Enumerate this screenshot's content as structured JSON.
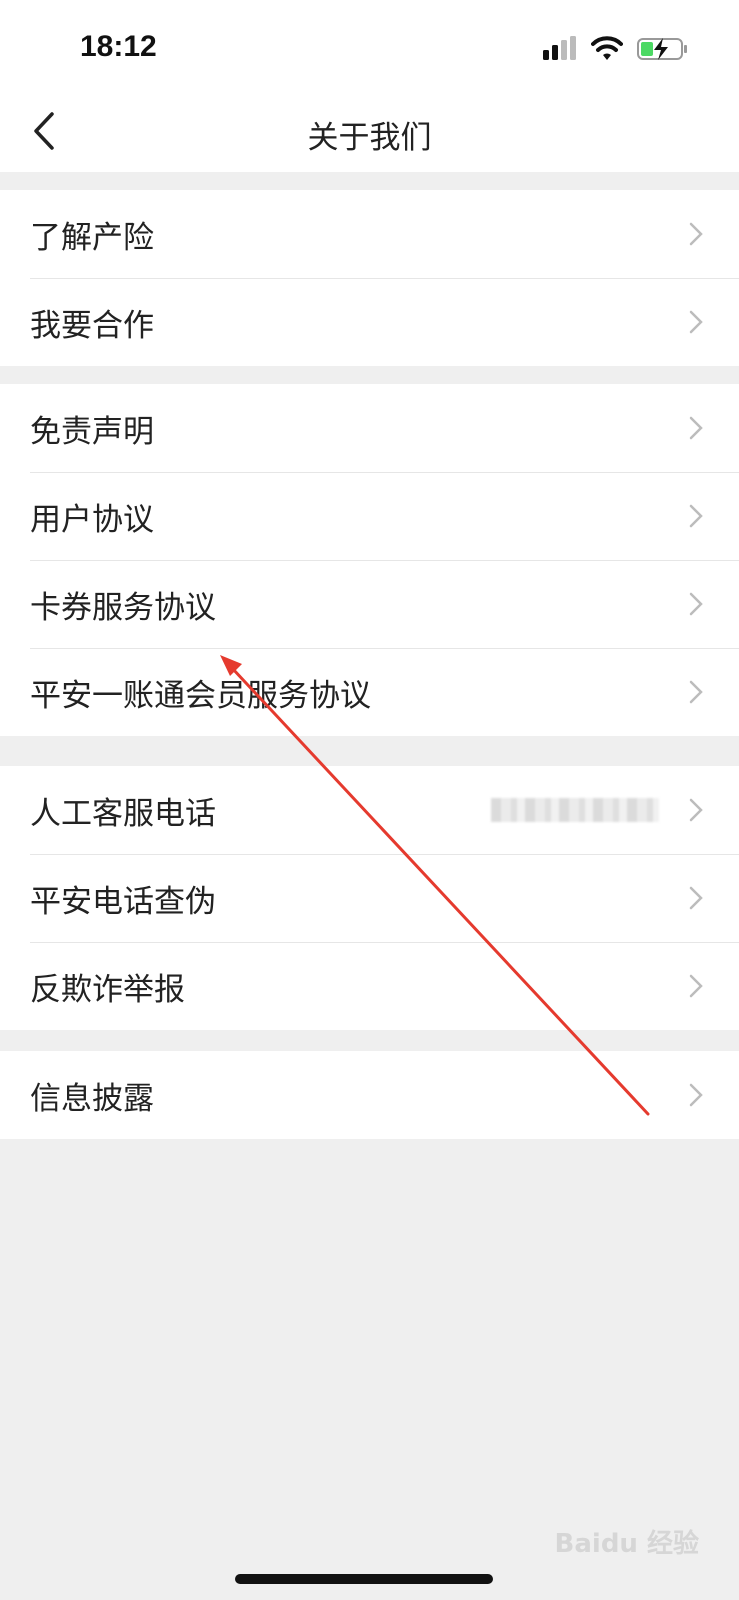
{
  "status_bar": {
    "time": "18:12",
    "icons": [
      "signal-icon",
      "wifi-icon",
      "battery-charging-icon"
    ]
  },
  "nav": {
    "title": "关于我们",
    "back_icon": "back-chevron-icon"
  },
  "groups": [
    {
      "items": [
        {
          "label": "了解产险"
        },
        {
          "label": "我要合作"
        }
      ]
    },
    {
      "items": [
        {
          "label": "免责声明"
        },
        {
          "label": "用户协议"
        },
        {
          "label": "卡券服务协议"
        },
        {
          "label": "平安一账通会员服务协议"
        }
      ]
    },
    {
      "items": [
        {
          "label": "人工客服电话"
        },
        {
          "label": "平安电话查伪"
        },
        {
          "label": "反欺诈举报"
        }
      ]
    },
    {
      "items": [
        {
          "label": "信息披露"
        }
      ]
    }
  ],
  "colors": {
    "background": "#efefef",
    "annotation_arrow": "#e53a2e",
    "battery": "#4cd964"
  },
  "watermark": "Baidu 经验"
}
